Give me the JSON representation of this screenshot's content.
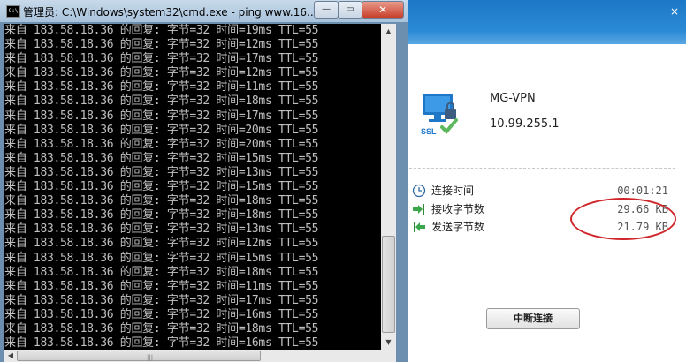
{
  "vpn": {
    "close_glyph": "×",
    "logo_label": "SSL",
    "name": "MG-VPN",
    "ip": "10.99.255.1",
    "stats": [
      {
        "icon": "clock-icon",
        "label": "连接时间",
        "value": "00:01:21"
      },
      {
        "icon": "receive-arrow-icon",
        "label": "接收字节数",
        "value": "29.66 KB"
      },
      {
        "icon": "send-arrow-icon",
        "label": "发送字节数",
        "value": "21.79 KB"
      }
    ],
    "disconnect_label": "中断连接",
    "colors": {
      "banner": "#2a8ad6",
      "highlight": "#d0262a",
      "check": "#5cb85c"
    }
  },
  "cmd": {
    "icon_text": "C:\\",
    "title": "管理员: C:\\Windows\\system32\\cmd.exe - ping  www.16...",
    "controls": {
      "minimize": "—",
      "maximize": "▭",
      "close": "✕"
    },
    "lines": [
      "来自 183.58.18.36 的回复: 字节=32 时间=19ms TTL=55",
      "来自 183.58.18.36 的回复: 字节=32 时间=12ms TTL=55",
      "来自 183.58.18.36 的回复: 字节=32 时间=17ms TTL=55",
      "来自 183.58.18.36 的回复: 字节=32 时间=12ms TTL=55",
      "来自 183.58.18.36 的回复: 字节=32 时间=11ms TTL=55",
      "来自 183.58.18.36 的回复: 字节=32 时间=18ms TTL=55",
      "来自 183.58.18.36 的回复: 字节=32 时间=17ms TTL=55",
      "来自 183.58.18.36 的回复: 字节=32 时间=20ms TTL=55",
      "来自 183.58.18.36 的回复: 字节=32 时间=20ms TTL=55",
      "来自 183.58.18.36 的回复: 字节=32 时间=15ms TTL=55",
      "来自 183.58.18.36 的回复: 字节=32 时间=13ms TTL=55",
      "来自 183.58.18.36 的回复: 字节=32 时间=15ms TTL=55",
      "来自 183.58.18.36 的回复: 字节=32 时间=18ms TTL=55",
      "来自 183.58.18.36 的回复: 字节=32 时间=18ms TTL=55",
      "来自 183.58.18.36 的回复: 字节=32 时间=13ms TTL=55",
      "来自 183.58.18.36 的回复: 字节=32 时间=12ms TTL=55",
      "来自 183.58.18.36 的回复: 字节=32 时间=15ms TTL=55",
      "来自 183.58.18.36 的回复: 字节=32 时间=18ms TTL=55",
      "来自 183.58.18.36 的回复: 字节=32 时间=11ms TTL=55",
      "来自 183.58.18.36 的回复: 字节=32 时间=17ms TTL=55",
      "来自 183.58.18.36 的回复: 字节=32 时间=16ms TTL=55",
      "来自 183.58.18.36 的回复: 字节=32 时间=18ms TTL=55",
      "来自 183.58.18.36 的回复: 字节=32 时间=16ms TTL=55"
    ],
    "scroll": {
      "up": "▲",
      "down": "▼",
      "left": "◀",
      "grip": "|||"
    }
  }
}
